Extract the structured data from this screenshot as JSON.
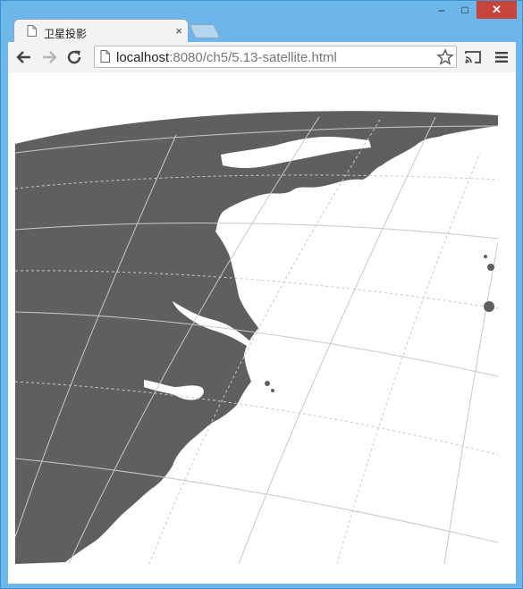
{
  "window": {
    "minimize_label": "–",
    "maximize_label": "□",
    "close_label": "✕"
  },
  "tab": {
    "title": "卫星投影",
    "close_label": "×",
    "icon": "page-icon"
  },
  "toolbar": {
    "back_icon": "back-arrow-icon",
    "forward_icon": "forward-arrow-icon",
    "reload_icon": "reload-icon",
    "url_host": "localhost",
    "url_rest": ":8080/ch5/5.13-satellite.html",
    "bookmark_icon": "star-icon",
    "cast_icon": "cast-icon",
    "menu_icon": "menu-icon"
  },
  "map": {
    "land_color": "#5f5f5f",
    "water_color": "#ffffff",
    "graticule_color": "#c8c8c8"
  }
}
